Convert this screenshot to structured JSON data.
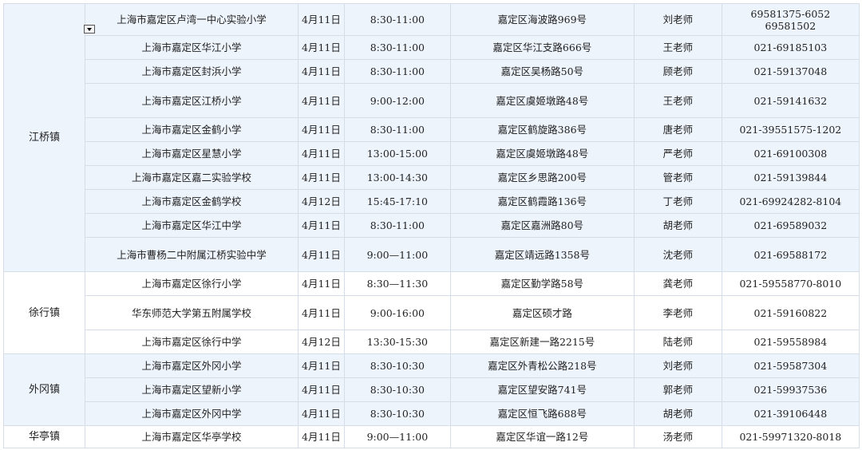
{
  "table": {
    "groups": [
      {
        "town": "江桥镇",
        "band": "blue",
        "rows": [
          {
            "school": "上海市嘉定区卢湾一中心实验小学",
            "date": "4月11日",
            "time": "8:30-11:00",
            "address": "嘉定区海波路969号",
            "contact": "刘老师",
            "phone": "69581375-6052",
            "phone2": "69581502",
            "h": 40
          },
          {
            "school": "上海市嘉定区华江小学",
            "date": "4月11日",
            "time": "8:30-11:00",
            "address": "嘉定区华江支路666号",
            "contact": "王老师",
            "phone": "021-69185103",
            "h": 30
          },
          {
            "school": "上海市嘉定区封浜小学",
            "date": "4月11日",
            "time": "8:30-11:00",
            "address": "嘉定区吴杨路50号",
            "contact": "顾老师",
            "phone": "021-59137048",
            "h": 30
          },
          {
            "school": "上海市嘉定区江桥小学",
            "date": "4月11日",
            "time": "9:00-12:00",
            "address": "嘉定区虞姬墩路48号",
            "contact": "王老师",
            "phone": "021-59141632",
            "h": 43
          },
          {
            "school": "上海市嘉定区金鹤小学",
            "date": "4月11日",
            "time": "8:30-11:00",
            "address": "嘉定区鹤旋路386号",
            "contact": "唐老师",
            "phone": "021-39551575-1202",
            "h": 30
          },
          {
            "school": "上海市嘉定区星慧小学",
            "date": "4月11日",
            "time": "13:00-15:00",
            "address": "嘉定区虞姬墩路48号",
            "contact": "严老师",
            "phone": "021-69100308",
            "h": 30
          },
          {
            "school": "上海市嘉定区嘉二实验学校",
            "date": "4月11日",
            "time": "13:00-14:30",
            "address": "嘉定区乡思路200号",
            "contact": "管老师",
            "phone": "021-59139844",
            "h": 30
          },
          {
            "school": "上海市嘉定区金鹤学校",
            "date": "4月12日",
            "time": "15:45-17:10",
            "address": "嘉定区鹤霞路136号",
            "contact": "丁老师",
            "phone": "021-69924282-8104",
            "h": 30
          },
          {
            "school": "上海市嘉定区华江中学",
            "date": "4月11日",
            "time": "8:30-11:00",
            "address": "嘉定区嘉洲路80号",
            "contact": "胡老师",
            "phone": "021-69589032",
            "h": 30
          },
          {
            "school": "上海市曹杨二中附属江桥实验中学",
            "date": "4月11日",
            "time": "9:00—11:00",
            "address": "嘉定区靖远路1358号",
            "contact": "沈老师",
            "phone": "021-69588172",
            "h": 43
          }
        ]
      },
      {
        "town": "徐行镇",
        "band": "white",
        "rows": [
          {
            "school": "上海市嘉定区徐行小学",
            "date": "4月11日",
            "time": "8:30—11:30",
            "address": "嘉定区勤学路58号",
            "contact": "龚老师",
            "phone": "021-59558770-8010",
            "h": 30
          },
          {
            "school": "华东师范大学第五附属学校",
            "date": "4月11日",
            "time": "9:00-16:00",
            "address": "嘉定区硕才路",
            "contact": "李老师",
            "phone": "021-59160822",
            "h": 43
          },
          {
            "school": "上海市嘉定区徐行中学",
            "date": "4月12日",
            "time": "13:30-15:30",
            "address": "嘉定区新建一路2215号",
            "contact": "陆老师",
            "phone": "021-59558984",
            "h": 30
          }
        ]
      },
      {
        "town": "外冈镇",
        "band": "blue",
        "rows": [
          {
            "school": "上海市嘉定区外冈小学",
            "date": "4月11日",
            "time": "8:30-10:30",
            "address": "嘉定区外青松公路218号",
            "contact": "刘老师",
            "phone": "021-59587304",
            "h": 30
          },
          {
            "school": "上海市嘉定区望新小学",
            "date": "4月11日",
            "time": "8:30-10:30",
            "address": "嘉定区望安路741号",
            "contact": "郭老师",
            "phone": "021-59937536",
            "h": 30
          },
          {
            "school": "上海市嘉定区外冈中学",
            "date": "4月11日",
            "time": "8:30-10:30",
            "address": "嘉定区恒飞路688号",
            "contact": "胡老师",
            "phone": "021-39106448",
            "h": 30
          }
        ]
      },
      {
        "town": "华亭镇",
        "band": "white",
        "rows": [
          {
            "school": "上海市嘉定区华亭学校",
            "date": "4月11日",
            "time": "9:00—11:00",
            "address": "嘉定区华谊一路12号",
            "contact": "汤老师",
            "phone": "021-59971320-8018",
            "h": 28
          }
        ]
      }
    ]
  }
}
